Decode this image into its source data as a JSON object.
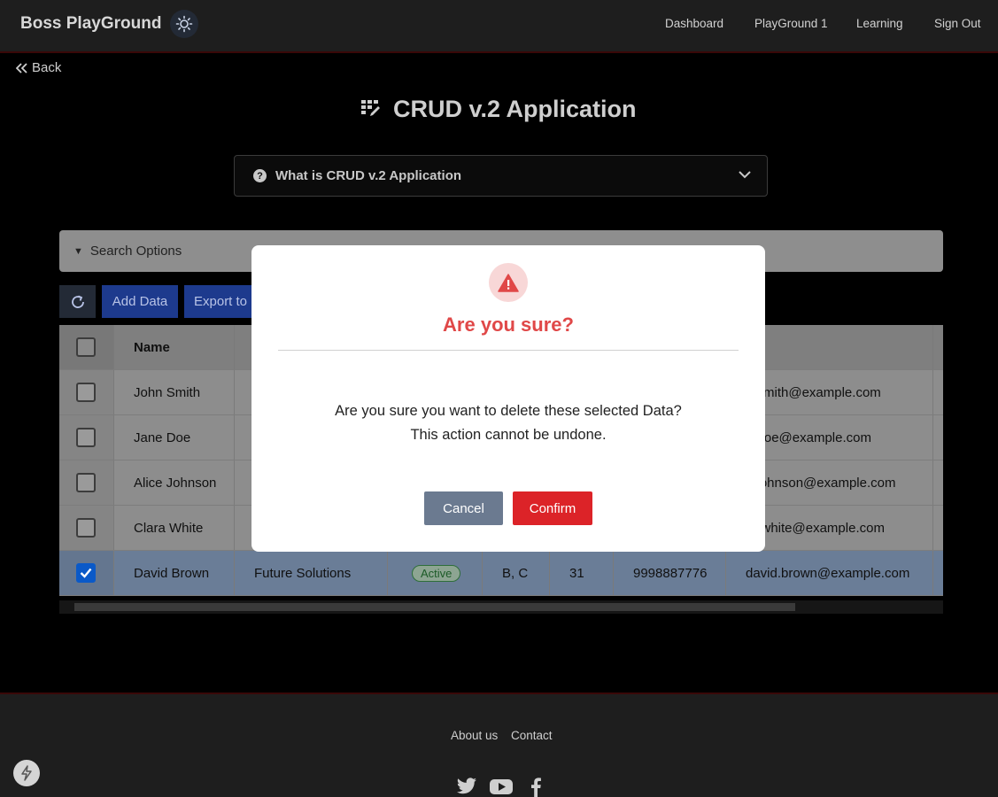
{
  "navbar": {
    "brand": "Boss PlayGround",
    "theme_icon": "sun-icon",
    "links": [
      "Dashboard",
      "PlayGround 1",
      "Learning",
      "Sign Out"
    ]
  },
  "page": {
    "back_label": "Back",
    "title": "CRUD v.2 Application",
    "title_icon": "grid-icon",
    "accordion_label": "What is CRUD v.2 Application",
    "search_options_label": "Search Options"
  },
  "toolbar": {
    "refresh_icon": "refresh-icon",
    "add_label": "Add Data",
    "export_label": "Export to"
  },
  "table": {
    "headers": [
      "Name",
      "",
      "",
      "",
      "",
      "",
      "ail"
    ],
    "rows": [
      {
        "name": "John Smith",
        "company": "",
        "status": "",
        "tags": "",
        "age": "",
        "phone": "",
        "email": "n.smith@example.com",
        "checked": false
      },
      {
        "name": "Jane Doe",
        "company": "",
        "status": "",
        "tags": "",
        "age": "",
        "phone": "",
        "email": "e.doe@example.com",
        "checked": false
      },
      {
        "name": "Alice Johnson",
        "company": "",
        "status": "",
        "tags": "",
        "age": "",
        "phone": "",
        "email": "e.johnson@example.com",
        "checked": false
      },
      {
        "name": "Clara White",
        "company": "",
        "status": "",
        "tags": "",
        "age": "",
        "phone": "",
        "email": "ra.white@example.com",
        "checked": false
      },
      {
        "name": "David Brown",
        "company": "Future Solutions",
        "status": "Active",
        "tags": "B, C",
        "age": "31",
        "phone": "9998887776",
        "email": "david.brown@example.com",
        "checked": true
      }
    ]
  },
  "modal": {
    "icon": "warning-icon",
    "title": "Are you sure?",
    "message_line1": "Are you sure you want to delete these selected Data?",
    "message_line2": "This action cannot be undone.",
    "cancel_label": "Cancel",
    "confirm_label": "Confirm"
  },
  "footer": {
    "links": [
      "About us",
      "Contact"
    ],
    "social": [
      "twitter-icon",
      "youtube-icon",
      "facebook-icon"
    ]
  },
  "colors": {
    "modal_title": "#e04848",
    "confirm": "#dc2328",
    "cancel": "#6b7a90",
    "primary": "#1d3a8d"
  }
}
